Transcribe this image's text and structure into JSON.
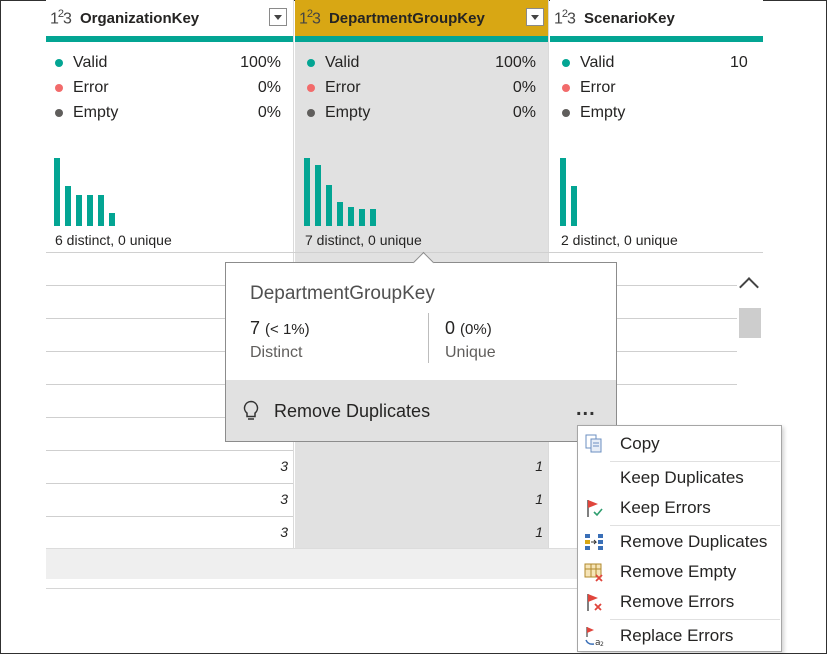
{
  "columns": [
    {
      "name": "OrganizationKey",
      "type_icon": "1²3",
      "quality": [
        {
          "label": "Valid",
          "pct": "100%",
          "color": "#03a593"
        },
        {
          "label": "Error",
          "pct": "0%",
          "color": "#f26b6b"
        },
        {
          "label": "Empty",
          "pct": "0%",
          "color": "#605e5c"
        }
      ],
      "histogram": [
        0.71,
        0.42,
        0.32,
        0.32,
        0.32,
        0.14
      ],
      "distinct_summary": "6 distinct, 0 unique",
      "cells": [
        "3",
        "3",
        "3"
      ]
    },
    {
      "name": "DepartmentGroupKey",
      "type_icon": "1²3",
      "quality": [
        {
          "label": "Valid",
          "pct": "100%",
          "color": "#03a593"
        },
        {
          "label": "Error",
          "pct": "0%",
          "color": "#f26b6b"
        },
        {
          "label": "Empty",
          "pct": "0%",
          "color": "#605e5c"
        }
      ],
      "histogram": [
        0.71,
        0.64,
        0.43,
        0.25,
        0.2,
        0.18,
        0.18
      ],
      "distinct_summary": "7 distinct, 0 unique",
      "cells": [
        "1",
        "1",
        "1"
      ]
    },
    {
      "name": "ScenarioKey",
      "type_icon": "1²3",
      "quality": [
        {
          "label": "Valid",
          "pct": "10",
          "color": "#03a593"
        },
        {
          "label": "Error",
          "pct": "",
          "color": "#f26b6b"
        },
        {
          "label": "Empty",
          "pct": "",
          "color": "#605e5c"
        }
      ],
      "histogram": [
        0.71,
        0.42
      ],
      "distinct_summary": "2 distinct, 0 unique",
      "cells": []
    }
  ],
  "popup": {
    "title": "DepartmentGroupKey",
    "distinct_value": "7",
    "distinct_pct": "(< 1%)",
    "distinct_label": "Distinct",
    "unique_value": "0",
    "unique_pct": "(0%)",
    "unique_label": "Unique",
    "action_label": "Remove Duplicates",
    "more_label": "..."
  },
  "menu": {
    "items": [
      {
        "label": "Copy",
        "icon": "copy-icon"
      },
      {
        "label": "Keep Duplicates",
        "icon": ""
      },
      {
        "label": "Keep Errors",
        "icon": "keep-errors-icon"
      },
      {
        "label": "Remove Duplicates",
        "icon": "remove-duplicates-icon"
      },
      {
        "label": "Remove Empty",
        "icon": "remove-empty-icon"
      },
      {
        "label": "Remove Errors",
        "icon": "remove-errors-icon"
      },
      {
        "label": "Replace Errors",
        "icon": "replace-errors-icon"
      }
    ]
  },
  "colors": {
    "accent": "#03a593",
    "selected_header": "#d8a714",
    "error": "#f26b6b"
  }
}
